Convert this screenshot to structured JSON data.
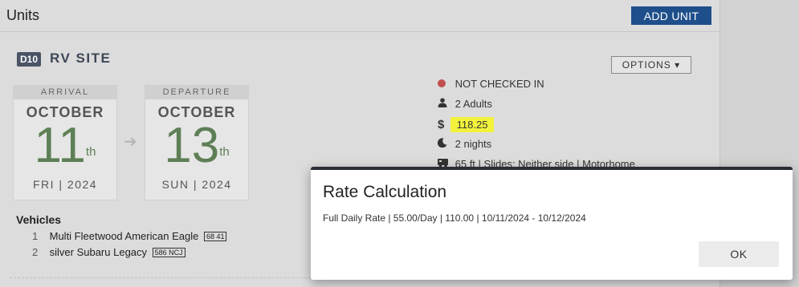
{
  "header": {
    "title": "Units",
    "add_unit_label": "ADD UNIT"
  },
  "unit": {
    "site_code": "D10",
    "site_type": "RV SITE",
    "options_label": "OPTIONS"
  },
  "arrival": {
    "label": "ARRIVAL",
    "month": "OCTOBER",
    "day": "11",
    "suffix": "th",
    "dow_year": "FRI | 2024"
  },
  "departure": {
    "label": "DEPARTURE",
    "month": "OCTOBER",
    "day": "13",
    "suffix": "th",
    "dow_year": "SUN | 2024"
  },
  "status": {
    "checkin": "NOT CHECKED IN",
    "guests": "2 Adults",
    "rate": "118.25",
    "nights": "2 nights",
    "rv": "65 ft | Slides: Neither side | Motorhome"
  },
  "vehicles": {
    "title": "Vehicles",
    "items": [
      {
        "num": "1",
        "desc": "Multi Fleetwood American Eagle",
        "plate": "68 41"
      },
      {
        "num": "2",
        "desc": "silver Subaru Legacy",
        "plate": "586 NCJ"
      }
    ]
  },
  "dialog": {
    "title": "Rate Calculation",
    "text": "Full Daily Rate | 55.00/Day | 110.00 | 10/11/2024 - 10/12/2024",
    "ok_label": "OK"
  },
  "colors": {
    "accent": "#1f4f8b",
    "date_green": "#5e7f55",
    "status_red": "#c0504d",
    "highlight": "#f2f23c"
  },
  "icons": [
    "status-dot-icon",
    "person-icon",
    "dollar-icon",
    "moon-icon",
    "rv-icon",
    "arrow-right-icon",
    "caret-down-icon"
  ]
}
